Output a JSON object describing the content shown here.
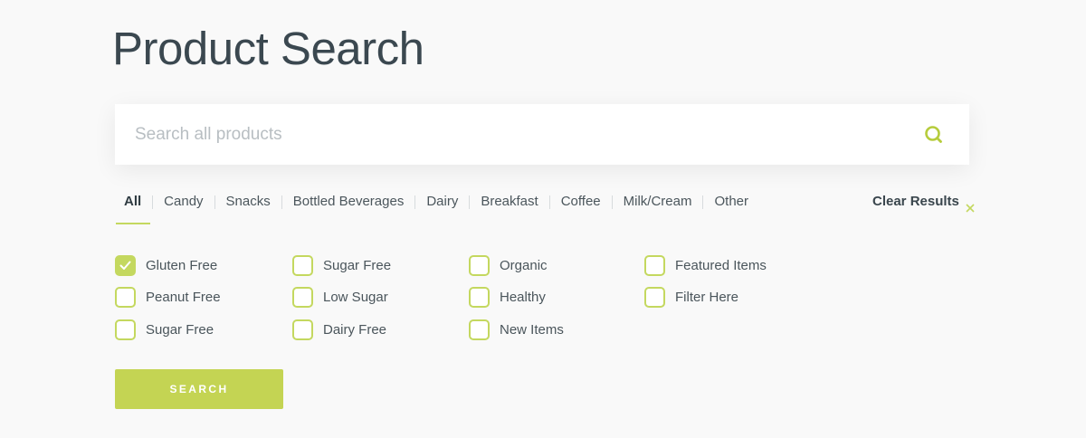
{
  "page": {
    "title": "Product Search"
  },
  "search": {
    "placeholder": "Search all products",
    "value": "",
    "icon": "search-icon"
  },
  "tabs": [
    {
      "label": "All",
      "active": true
    },
    {
      "label": "Candy",
      "active": false
    },
    {
      "label": "Snacks",
      "active": false
    },
    {
      "label": "Bottled Beverages",
      "active": false
    },
    {
      "label": "Dairy",
      "active": false
    },
    {
      "label": "Breakfast",
      "active": false
    },
    {
      "label": "Coffee",
      "active": false
    },
    {
      "label": "Milk/Cream",
      "active": false
    },
    {
      "label": "Other",
      "active": false
    }
  ],
  "clear": {
    "label": "Clear Results",
    "icon": "close-icon"
  },
  "filters": {
    "columns": [
      [
        {
          "label": "Gluten Free",
          "checked": true
        },
        {
          "label": "Peanut Free",
          "checked": false
        },
        {
          "label": "Sugar Free",
          "checked": false
        }
      ],
      [
        {
          "label": "Sugar Free",
          "checked": false
        },
        {
          "label": "Low Sugar",
          "checked": false
        },
        {
          "label": "Dairy Free",
          "checked": false
        }
      ],
      [
        {
          "label": "Organic",
          "checked": false
        },
        {
          "label": "Healthy",
          "checked": false
        },
        {
          "label": "New Items",
          "checked": false
        }
      ],
      [
        {
          "label": "Featured Items",
          "checked": false
        },
        {
          "label": "Filter Here",
          "checked": false
        }
      ]
    ]
  },
  "button": {
    "label": "SEARCH"
  },
  "colors": {
    "accent": "#c4d85f",
    "button": "#c4d453",
    "title": "#3b4850",
    "background": "#f9f9f9"
  }
}
